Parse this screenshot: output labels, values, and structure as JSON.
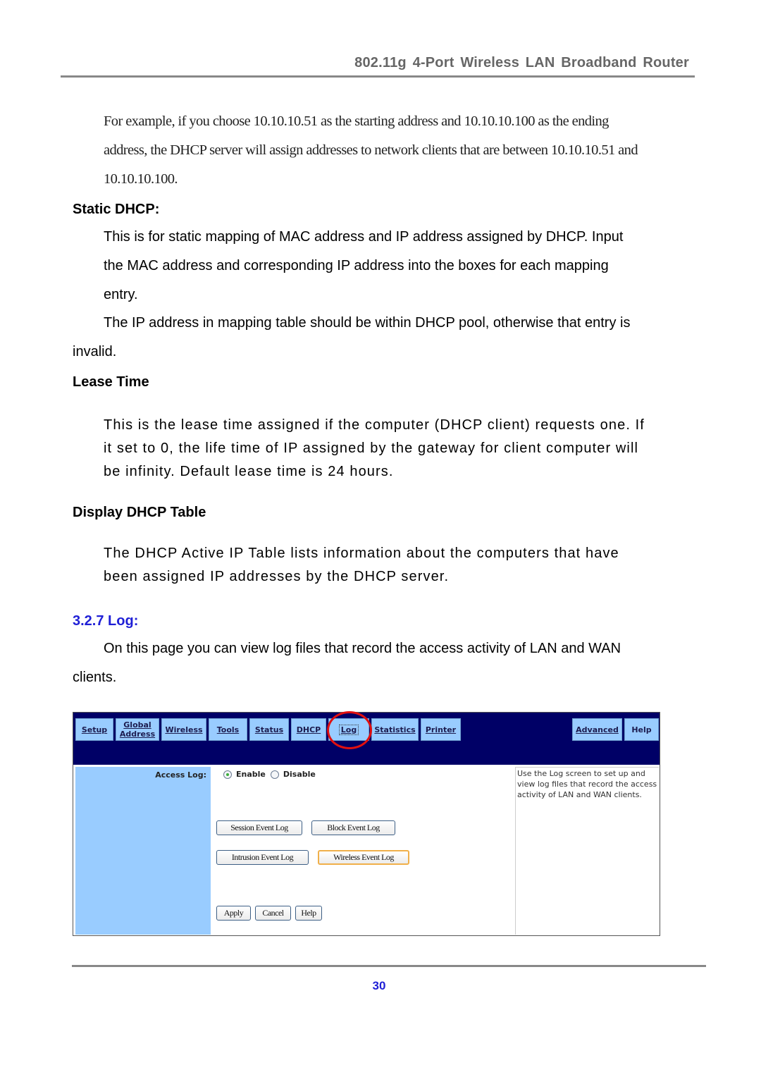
{
  "header": {
    "title": "802.11g 4-Port Wireless LAN Broadband Router"
  },
  "intro": {
    "line1": "For example, if you choose 10.10.10.51 as the starting address and 10.10.10.100 as the ending",
    "line2": "address, the DHCP server will assign addresses to network clients that are between 10.10.10.51 and",
    "line3": "10.10.10.100."
  },
  "static_dhcp": {
    "heading": "Static DHCP:",
    "p1_line1": "This is for static mapping of MAC address and IP address assigned by DHCP. Input",
    "p1_line2": "the MAC address and corresponding IP address into the boxes for each mapping",
    "p1_line3": "entry.",
    "p2_line1": "The IP address in mapping table should be within DHCP pool, otherwise that entry is",
    "p2_line2": "invalid."
  },
  "lease_time": {
    "heading": "Lease Time",
    "line1": "This is the lease time assigned if the computer (DHCP client) requests one. If",
    "line2": "it set to 0, the life time of IP assigned by the gateway for client computer will",
    "line3": "be infinity. Default lease time is 24 hours."
  },
  "display_table": {
    "heading": "Display DHCP Table",
    "line1": "The DHCP Active IP Table lists information about the computers that have",
    "line2": "been assigned IP addresses by the DHCP server."
  },
  "log_section": {
    "heading": "3.2.7 Log:",
    "line1": "On this page you can view log files that record the access activity of LAN and WAN",
    "line2": "clients."
  },
  "router_ui": {
    "tabs": {
      "setup": "Setup",
      "global_line1": "Global",
      "global_line2": "Address",
      "wireless": "Wireless",
      "tools": "Tools",
      "status": "Status",
      "dhcp": "DHCP",
      "log": "Log",
      "statistics": "Statistics",
      "printer": "Printer",
      "advanced": "Advanced",
      "help": "Help"
    },
    "access_log_label": "Access Log:",
    "radio": {
      "enable": "Enable",
      "disable": "Disable",
      "selected": "Enable"
    },
    "buttons": {
      "session": "Session Event Log",
      "block": "Block Event Log",
      "intrusion": "Intrusion Event Log",
      "wireless": "Wireless Event Log",
      "apply": "Apply",
      "cancel": "Cancel",
      "help": "Help"
    },
    "help_text": "Use the Log screen to set up and view log files that record the access activity of LAN and WAN clients.",
    "colors": {
      "nav_bg": "#000066",
      "tab_bg": "#99ccff",
      "highlight_circle": "#e01010"
    }
  },
  "footer": {
    "page_number": "30"
  }
}
